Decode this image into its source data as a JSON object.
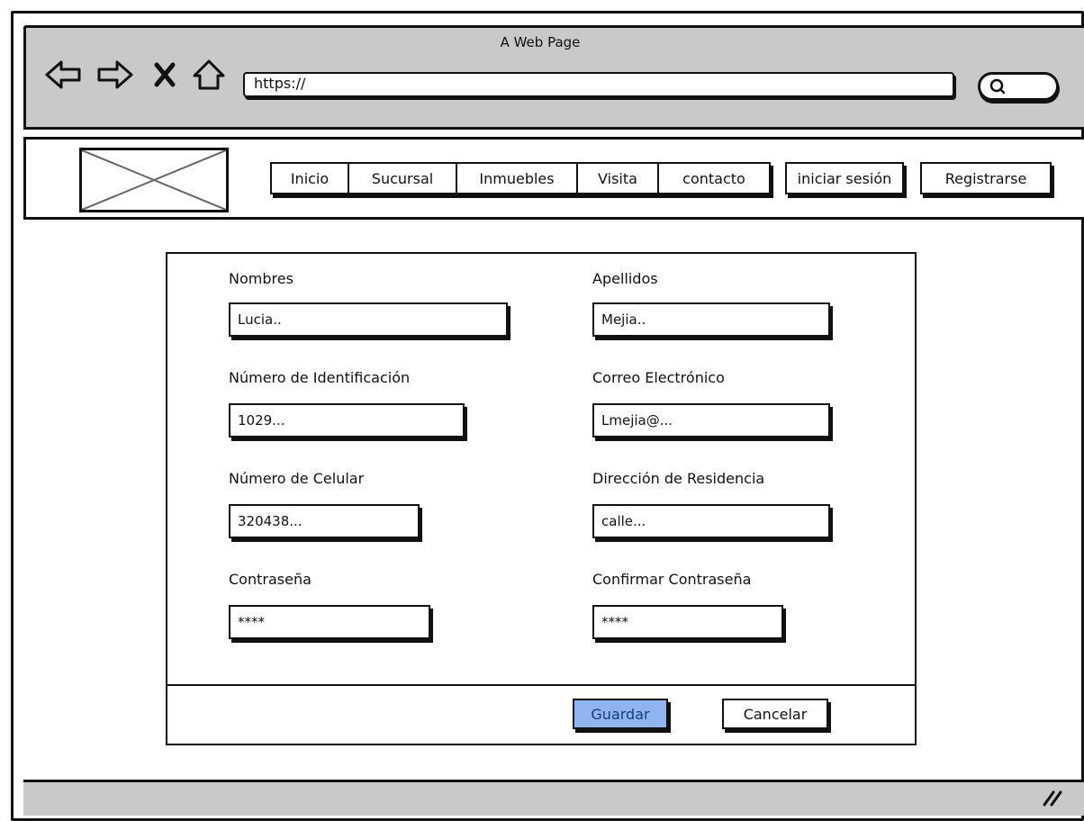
{
  "window": {
    "title": "A Web Page"
  },
  "toolbar": {
    "url": "https://",
    "back_icon": "◁",
    "forward_icon": "▷",
    "stop_icon": "✕",
    "home_icon": "⌂",
    "search_icon": "🔍"
  },
  "header": {
    "nav_items": [
      "Inicio",
      "Sucursal",
      "Inmuebles",
      "Visita",
      "contacto"
    ],
    "login_label": "iniciar sesión",
    "register_label": "Registrarse"
  },
  "form": {
    "fields": [
      {
        "label": "Nombres",
        "value": "Lucia.."
      },
      {
        "label": "Apellidos",
        "value": "Mejia.."
      },
      {
        "label": "Número de Identificación",
        "value": "1029..."
      },
      {
        "label": "Correo Electrónico",
        "value": "Lmejia@..."
      },
      {
        "label": "Número de Celular",
        "value": "320438..."
      },
      {
        "label": "Dirección de Residencia",
        "value": "calle..."
      },
      {
        "label": "Contraseña",
        "value": "****"
      },
      {
        "label": "Confirmar Contraseña",
        "value": "****"
      }
    ],
    "save_label": "Guardar",
    "cancel_label": "Cancelar"
  },
  "colors": {
    "primary_button": "#8fb4f0",
    "chrome": "#c9c9c9"
  }
}
